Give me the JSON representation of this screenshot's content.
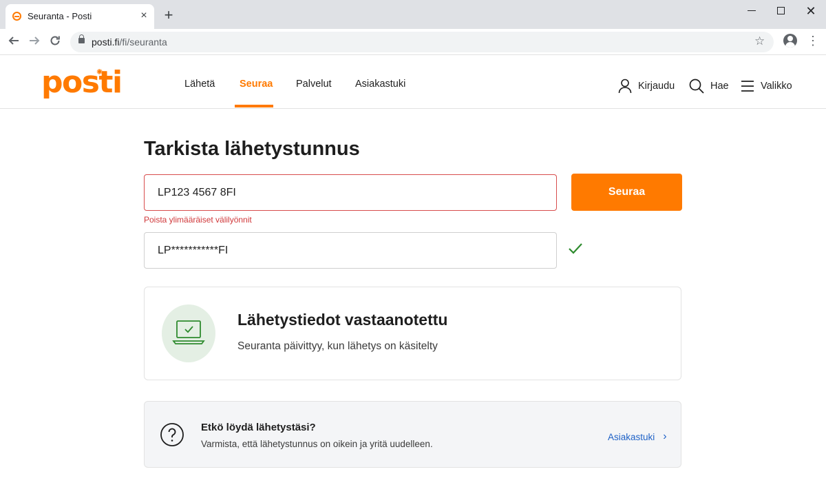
{
  "browser": {
    "tab_title": "Seuranta - Posti",
    "tab_close": "×",
    "new_tab": "+",
    "url_host": "posti.fi",
    "url_path": "/fi/seuranta"
  },
  "site": {
    "logo_text": "posti",
    "nav": [
      {
        "label": "Lähetä"
      },
      {
        "label": "Seuraa"
      },
      {
        "label": "Palvelut"
      },
      {
        "label": "Asiakastuki"
      }
    ],
    "actions": {
      "login": "Kirjaudu",
      "search": "Hae",
      "menu": "Valikko"
    }
  },
  "tracking": {
    "title": "Tarkista lähetystunnus",
    "input_value": "LP123 4567 8FI",
    "error_message": "Poista ylimääräiset välilyönnit",
    "masked_value": "LP***********FI",
    "button_label": "Seuraa"
  },
  "status_card": {
    "title": "Lähetystiedot vastaanotettu",
    "subtitle": "Seuranta päivittyy, kun lähetys on käsitelty"
  },
  "help_card": {
    "title": "Etkö löydä lähetystäsi?",
    "subtitle": "Varmista, että lähetystunnus on oikein ja yritä uudelleen.",
    "link_label": "Asiakastuki"
  },
  "colors": {
    "brand_orange": "#ff7a00",
    "error_red": "#d0383a",
    "success_green": "#2e8b2e",
    "link_blue": "#1f62c7"
  }
}
